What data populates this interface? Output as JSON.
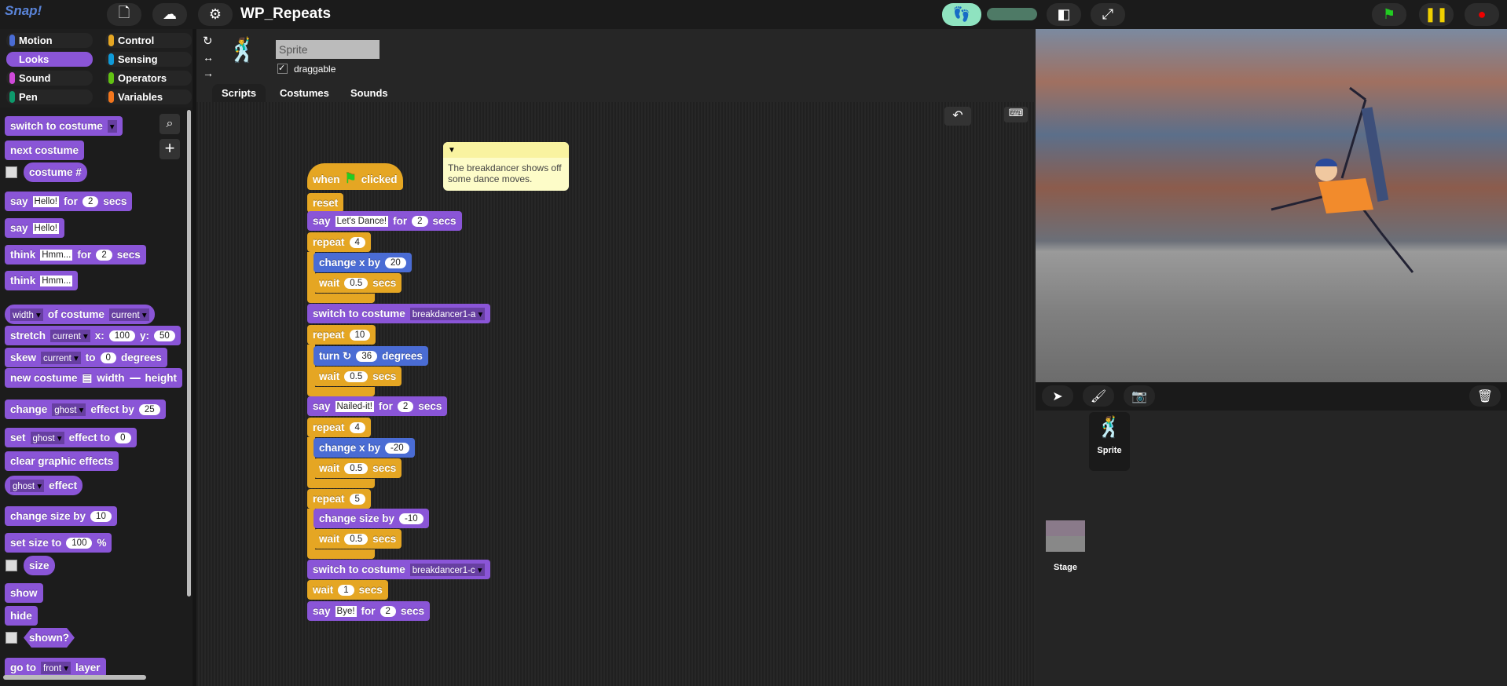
{
  "app": {
    "logo": "Snap!",
    "project_title": "WP_Repeats"
  },
  "categories": [
    {
      "label": "Motion",
      "color": "#4a6cd4"
    },
    {
      "label": "Control",
      "color": "#e5a623"
    },
    {
      "label": "Looks",
      "color": "#8a55d7"
    },
    {
      "label": "Sensing",
      "color": "#0f9ad8"
    },
    {
      "label": "Sound",
      "color": "#cf4ad9"
    },
    {
      "label": "Operators",
      "color": "#62c213"
    },
    {
      "label": "Pen",
      "color": "#0e9a6c"
    },
    {
      "label": "Variables",
      "color": "#f3761d"
    }
  ],
  "sprite": {
    "name": "Sprite",
    "draggable_label": "draggable"
  },
  "tabs": [
    "Scripts",
    "Costumes",
    "Sounds"
  ],
  "palette": [
    [
      {
        "t": "switch to costume"
      },
      {
        "d": ""
      }
    ],
    [
      {
        "t": "next costume"
      }
    ],
    [
      {
        "t": "costume #",
        "rep": 1
      }
    ],
    [
      {
        "t": "say"
      },
      {
        "x": "Hello!"
      },
      {
        "t": "for"
      },
      {
        "n": "2"
      },
      {
        "t": "secs"
      }
    ],
    [
      {
        "t": "say"
      },
      {
        "x": "Hello!"
      }
    ],
    [
      {
        "t": "think"
      },
      {
        "x": "Hmm..."
      },
      {
        "t": "for"
      },
      {
        "n": "2"
      },
      {
        "t": "secs"
      }
    ],
    [
      {
        "t": "think"
      },
      {
        "x": "Hmm..."
      }
    ],
    [
      {
        "d": "width",
        "rep": 1
      },
      {
        "t": "of costume"
      },
      {
        "d": "current"
      }
    ],
    [
      {
        "t": "stretch"
      },
      {
        "d": "current"
      },
      {
        "t": "x:"
      },
      {
        "n": "100"
      },
      {
        "t": "y:"
      },
      {
        "n": "50"
      }
    ],
    [
      {
        "t": "skew"
      },
      {
        "d": "current"
      },
      {
        "t": "to"
      },
      {
        "n": "0"
      },
      {
        "t": "degrees"
      }
    ],
    [
      {
        "t": "new costume"
      },
      {
        "t": "▤"
      },
      {
        "t": "width"
      },
      {
        "n": " "
      },
      {
        "t": "height"
      }
    ],
    [
      {
        "t": "change"
      },
      {
        "d": "ghost"
      },
      {
        "t": "effect by"
      },
      {
        "n": "25"
      }
    ],
    [
      {
        "t": "set"
      },
      {
        "d": "ghost"
      },
      {
        "t": "effect to"
      },
      {
        "n": "0"
      }
    ],
    [
      {
        "t": "clear graphic effects"
      }
    ],
    [
      {
        "d": "ghost",
        "rep": 1
      },
      {
        "t": "effect"
      }
    ],
    [
      {
        "t": "change size by"
      },
      {
        "n": "10"
      }
    ],
    [
      {
        "t": "set size to"
      },
      {
        "n": "100"
      },
      {
        "t": "%"
      }
    ],
    [
      {
        "t": "size",
        "rep": 1
      }
    ],
    [
      {
        "t": "show"
      }
    ],
    [
      {
        "t": "hide"
      }
    ],
    [
      {
        "t": "shown?",
        "pred": 1
      }
    ],
    [
      {
        "t": "go to"
      },
      {
        "d": "front"
      },
      {
        "t": "layer"
      }
    ]
  ],
  "script": [
    {
      "c": "control",
      "p": [
        {
          "t": "when"
        },
        {
          "flag": 1
        },
        {
          "t": "clicked"
        }
      ]
    },
    {
      "c": "control",
      "p": [
        {
          "t": "reset"
        }
      ]
    },
    {
      "c": "looks",
      "p": [
        {
          "t": "say"
        },
        {
          "x": "Let's Dance!"
        },
        {
          "t": "for"
        },
        {
          "n": "2"
        },
        {
          "t": "secs"
        }
      ]
    },
    {
      "c": "control",
      "p": [
        {
          "t": "repeat"
        },
        {
          "n": "4"
        }
      ]
    },
    {
      "c": "motion",
      "i": 1,
      "p": [
        {
          "t": "change x by"
        },
        {
          "n": "20"
        }
      ]
    },
    {
      "c": "control",
      "i": 1,
      "p": [
        {
          "t": "wait"
        },
        {
          "n": "0.5"
        },
        {
          "t": "secs"
        }
      ]
    },
    {
      "c": "looks",
      "p": [
        {
          "t": "switch to costume"
        },
        {
          "d": "breakdancer1-a"
        }
      ]
    },
    {
      "c": "control",
      "p": [
        {
          "t": "repeat"
        },
        {
          "n": "10"
        }
      ]
    },
    {
      "c": "motion",
      "i": 1,
      "p": [
        {
          "t": "turn ↻"
        },
        {
          "n": "36"
        },
        {
          "t": "degrees"
        }
      ]
    },
    {
      "c": "control",
      "i": 1,
      "p": [
        {
          "t": "wait"
        },
        {
          "n": "0.5"
        },
        {
          "t": "secs"
        }
      ]
    },
    {
      "c": "looks",
      "p": [
        {
          "t": "say"
        },
        {
          "x": "Nailed-it!"
        },
        {
          "t": "for"
        },
        {
          "n": "2"
        },
        {
          "t": "secs"
        }
      ]
    },
    {
      "c": "control",
      "p": [
        {
          "t": "repeat"
        },
        {
          "n": "4"
        }
      ]
    },
    {
      "c": "motion",
      "i": 1,
      "p": [
        {
          "t": "change x by"
        },
        {
          "n": "-20"
        }
      ]
    },
    {
      "c": "control",
      "i": 1,
      "p": [
        {
          "t": "wait"
        },
        {
          "n": "0.5"
        },
        {
          "t": "secs"
        }
      ]
    },
    {
      "c": "control",
      "p": [
        {
          "t": "repeat"
        },
        {
          "n": "5"
        }
      ]
    },
    {
      "c": "looks",
      "i": 1,
      "p": [
        {
          "t": "change size by"
        },
        {
          "n": "-10"
        }
      ]
    },
    {
      "c": "control",
      "i": 1,
      "p": [
        {
          "t": "wait"
        },
        {
          "n": "0.5"
        },
        {
          "t": "secs"
        }
      ]
    },
    {
      "c": "looks",
      "p": [
        {
          "t": "switch to costume"
        },
        {
          "d": "breakdancer1-c"
        }
      ]
    },
    {
      "c": "control",
      "p": [
        {
          "t": "wait"
        },
        {
          "n": "1"
        },
        {
          "t": "secs"
        }
      ]
    },
    {
      "c": "looks",
      "p": [
        {
          "t": "say"
        },
        {
          "x": "Bye!"
        },
        {
          "t": "for"
        },
        {
          "n": "2"
        },
        {
          "t": "secs"
        }
      ]
    }
  ],
  "comment": "The breakdancer shows off some dance moves.",
  "corral": {
    "sprite_label": "Sprite",
    "stage_label": "Stage"
  },
  "colors": {
    "looks": "#8a55d7",
    "control": "#e5a623",
    "motion": "#4a6cd4"
  }
}
